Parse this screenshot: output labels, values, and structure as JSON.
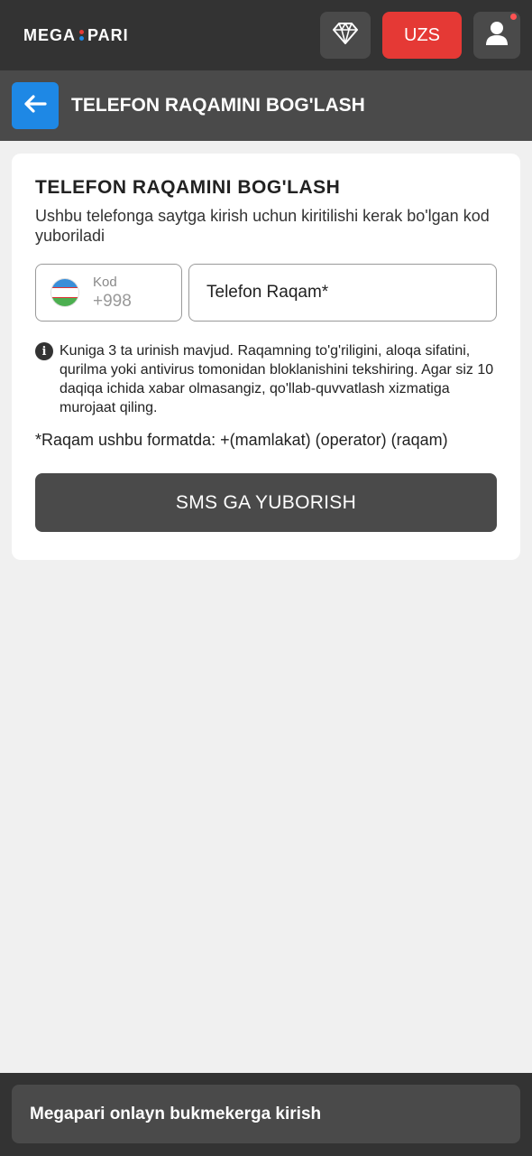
{
  "header": {
    "logo_left": "MEGA",
    "logo_right": "PARI",
    "currency_label": "UZS",
    "icons": [
      "diamond-icon",
      "user-icon"
    ]
  },
  "subheader": {
    "title": "TELEFON RAQAMINI BOG'LASH"
  },
  "card": {
    "title": "TELEFON RAQAMINI BOG'LASH",
    "description": "Ushbu telefonga saytga kirish uchun kiritilishi kerak bo'lgan kod yuboriladi",
    "code_label": "Kod",
    "code_value": "+998",
    "phone_placeholder": "Telefon Raqam*",
    "info_text": "Kuniga 3 ta urinish mavjud. Raqamning to'g'riligini, aloqa sifatini, qurilma yoki antivirus tomonidan bloklanishini tekshiring. Agar siz 10 daqiqa ichida xabar olmasangiz, qo'llab-quvvatlash xizmatiga murojaat qiling.",
    "format_note": "*Raqam ushbu formatda: +(mamlakat) (operator) (raqam)",
    "submit_label": "SMS GA YUBORISH"
  },
  "footer": {
    "label": "Megapari onlayn bukmekerga kirish"
  },
  "colors": {
    "topbar": "#333333",
    "subheader": "#4a4a4a",
    "currency_button": "#e53935",
    "back_button": "#1e88e5",
    "logo_dot_top": "#e53935",
    "logo_dot_bottom": "#1e88e5"
  }
}
